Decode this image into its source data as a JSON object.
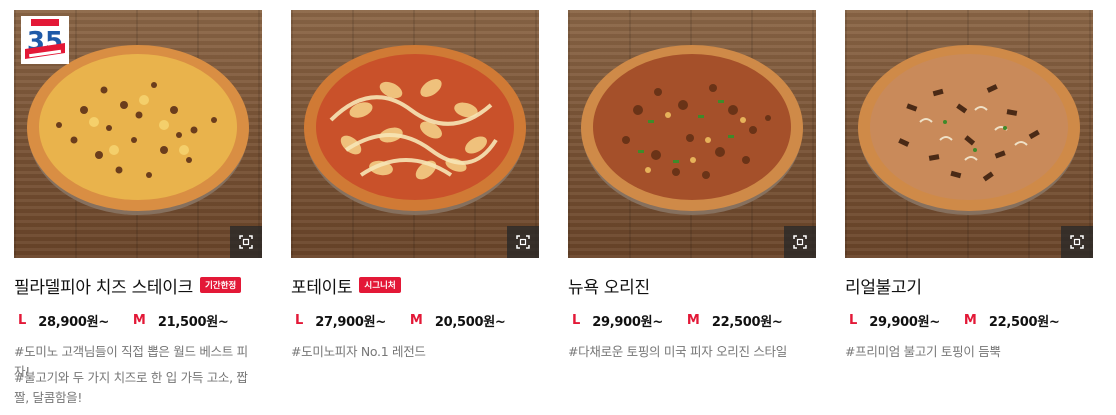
{
  "products": [
    {
      "name": "필라델피아 치즈 스테이크",
      "tag": "기간한정",
      "price_l_label": "L",
      "price_l": "28,900원~",
      "price_m_label": "M",
      "price_m": "21,500원~",
      "desc1": "#도미노 고객님들이 직접 뽑은 월드 베스트 피자!",
      "desc2": "#불고기와 두 가지 치즈로 한 입 가득 고소, 짭짤, 달콤함을!",
      "badge": "35",
      "image_icon": "pizza-photo",
      "zoom_icon": "zoom-icon"
    },
    {
      "name": "포테이토",
      "tag": "시그니처",
      "price_l_label": "L",
      "price_l": "27,900원~",
      "price_m_label": "M",
      "price_m": "20,500원~",
      "desc1": "#도미노피자 No.1 레전드",
      "desc2": "",
      "image_icon": "pizza-photo",
      "zoom_icon": "zoom-icon"
    },
    {
      "name": "뉴욕 오리진",
      "tag": "",
      "price_l_label": "L",
      "price_l": "29,900원~",
      "price_m_label": "M",
      "price_m": "22,500원~",
      "desc1": "#다채로운 토핑의 미국 피자 오리진 스타일",
      "desc2": "",
      "image_icon": "pizza-photo",
      "zoom_icon": "zoom-icon"
    },
    {
      "name": "리얼불고기",
      "tag": "",
      "price_l_label": "L",
      "price_l": "29,900원~",
      "price_m_label": "M",
      "price_m": "22,500원~",
      "desc1": "#프리미엄 불고기 토핑이 듬뿍",
      "desc2": "",
      "image_icon": "pizza-photo",
      "zoom_icon": "zoom-icon"
    }
  ],
  "colors": {
    "accent": "#e31837",
    "text": "#111111",
    "muted": "#777777",
    "wood": "#7b5537"
  }
}
